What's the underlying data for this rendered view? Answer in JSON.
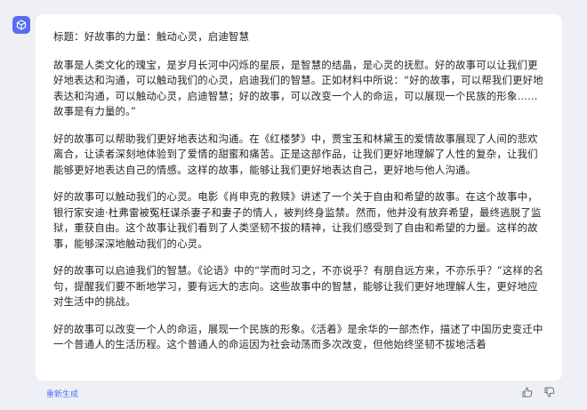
{
  "colors": {
    "accent": "#5a6cf0",
    "link": "#4c6ef5",
    "text": "#1f2329",
    "background": "#eef0f5"
  },
  "icons": {
    "avatar": "bot-cube-icon",
    "thumbs_up": "thumbs-up-icon",
    "thumbs_down": "thumbs-down-icon"
  },
  "message": {
    "paragraphs": [
      "标题：好故事的力量：触动心灵，启迪智慧",
      "故事是人类文化的瑰宝，是岁月长河中闪烁的星辰，是智慧的结晶，是心灵的抚慰。好的故事可以让我们更好地表达和沟通，可以触动我们的心灵，启迪我们的智慧。正如材料中所说：“好的故事，可以帮我们更好地表达和沟通，可以触动心灵，启迪智慧；好的故事，可以改变一个人的命运，可以展现一个民族的形象……故事是有力量的。”",
      "好的故事可以帮助我们更好地表达和沟通。在《红楼梦》中，贾宝玉和林黛玉的爱情故事展现了人间的悲欢离合，让读者深刻地体验到了爱情的甜蜜和痛苦。正是这部作品，让我们更好地理解了人性的复杂，让我们能够更好地表达自己的情感。这样的故事，能够让我们更好地表达自己，更好地与他人沟通。",
      "好的故事可以触动我们的心灵。电影《肖申克的救赎》讲述了一个关于自由和希望的故事。在这个故事中，银行家安迪·杜弗雷被冤枉谋杀妻子和妻子的情人，被判终身监禁。然而，他并没有放弃希望，最终逃脱了监狱，重获自由。这个故事让我们看到了人类坚韧不拔的精神，让我们感受到了自由和希望的力量。这样的故事，能够深深地触动我们的心灵。",
      "好的故事可以启迪我们的智慧。《论语》中的“学而时习之，不亦说乎？有朋自远方来，不亦乐乎？”这样的名句，提醒我们要不断地学习，要有远大的志向。这些故事中的智慧，能够让我们更好地理解人生，更好地应对生活中的挑战。",
      "好的故事可以改变一个人的命运，展现一个民族的形象。《活着》是余华的一部杰作，描述了中国历史变迁中一个普通人的生活历程。这个普通人的命运因为社会动荡而多次改变，但他始终坚韧不拔地活着"
    ]
  },
  "footer": {
    "regenerate_label": "重新生成"
  }
}
